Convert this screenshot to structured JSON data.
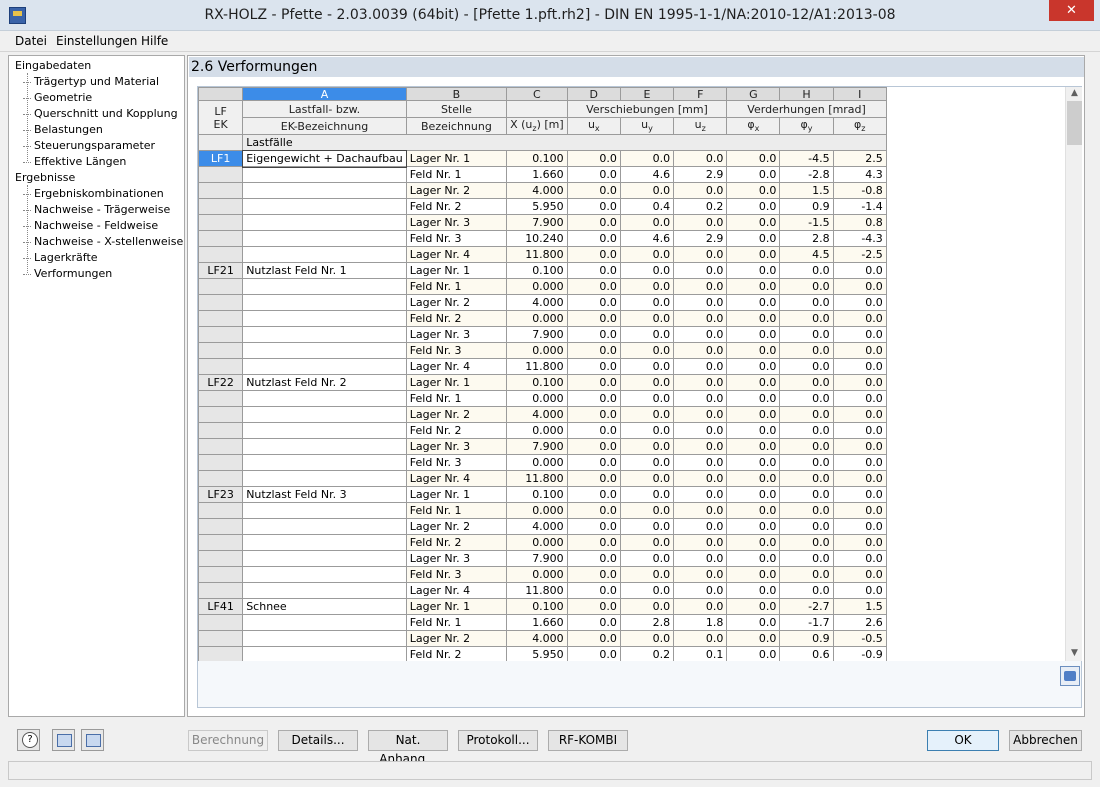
{
  "window": {
    "title": "RX-HOLZ - Pfette - 2.03.0039 (64bit) - [Pfette 1.pft.rh2] - DIN EN 1995-1-1/NA:2010-12/A1:2013-08",
    "close_glyph": "✕"
  },
  "menu": [
    "Datei",
    "Einstellungen",
    "Hilfe"
  ],
  "nav": {
    "groups": [
      {
        "label": "Eingabedaten",
        "items": [
          "Trägertyp und Material",
          "Geometrie",
          "Querschnitt und Kopplung",
          "Belastungen",
          "Steuerungsparameter",
          "Effektive Längen"
        ]
      },
      {
        "label": "Ergebnisse",
        "items": [
          "Ergebniskombinationen",
          "Nachweise - Trägerweise",
          "Nachweise - Feldweise",
          "Nachweise - X-stellenweise",
          "Lagerkräfte",
          "Verformungen"
        ]
      }
    ]
  },
  "panel": {
    "title": "2.6 Verformungen"
  },
  "table": {
    "col_letters": [
      "A",
      "B",
      "C",
      "D",
      "E",
      "F",
      "G",
      "H",
      "I"
    ],
    "header": {
      "lf_ek_1": "LF",
      "lf_ek_2": "EK",
      "a1": "Lastfall- bzw.",
      "a2": "EK-Bezeichnung",
      "b1": "Stelle",
      "b2": "Bezeichnung",
      "c2": "X (u",
      "c2_sub": "z",
      "c2_end": ") [m]",
      "def_group": "Verschiebungen [mm]",
      "rot_group": "Verderhungen [mrad]",
      "ux": "u",
      "ux_sub": "x",
      "uy": "u",
      "uy_sub": "y",
      "uz": "u",
      "uz_sub": "z",
      "px": "φ",
      "px_sub": "x",
      "py": "φ",
      "py_sub": "y",
      "pz": "φ",
      "pz_sub": "z"
    },
    "section_label": "Lastfälle",
    "groups": [
      {
        "lf": "LF1",
        "name": "Eigengewicht + Dachaufbau",
        "rows": [
          [
            "Lager Nr. 1",
            "0.100",
            "0.0",
            "0.0",
            "0.0",
            "0.0",
            "-4.5",
            "2.5"
          ],
          [
            "Feld Nr. 1",
            "1.660",
            "0.0",
            "4.6",
            "2.9",
            "0.0",
            "-2.8",
            "4.3"
          ],
          [
            "Lager Nr. 2",
            "4.000",
            "0.0",
            "0.0",
            "0.0",
            "0.0",
            "1.5",
            "-0.8"
          ],
          [
            "Feld Nr. 2",
            "5.950",
            "0.0",
            "0.4",
            "0.2",
            "0.0",
            "0.9",
            "-1.4"
          ],
          [
            "Lager Nr. 3",
            "7.900",
            "0.0",
            "0.0",
            "0.0",
            "0.0",
            "-1.5",
            "0.8"
          ],
          [
            "Feld Nr. 3",
            "10.240",
            "0.0",
            "4.6",
            "2.9",
            "0.0",
            "2.8",
            "-4.3"
          ],
          [
            "Lager Nr. 4",
            "11.800",
            "0.0",
            "0.0",
            "0.0",
            "0.0",
            "4.5",
            "-2.5"
          ]
        ]
      },
      {
        "lf": "LF21",
        "name": "Nutzlast Feld Nr. 1",
        "rows": [
          [
            "Lager Nr. 1",
            "0.100",
            "0.0",
            "0.0",
            "0.0",
            "0.0",
            "0.0",
            "0.0"
          ],
          [
            "Feld Nr. 1",
            "0.000",
            "0.0",
            "0.0",
            "0.0",
            "0.0",
            "0.0",
            "0.0"
          ],
          [
            "Lager Nr. 2",
            "4.000",
            "0.0",
            "0.0",
            "0.0",
            "0.0",
            "0.0",
            "0.0"
          ],
          [
            "Feld Nr. 2",
            "0.000",
            "0.0",
            "0.0",
            "0.0",
            "0.0",
            "0.0",
            "0.0"
          ],
          [
            "Lager Nr. 3",
            "7.900",
            "0.0",
            "0.0",
            "0.0",
            "0.0",
            "0.0",
            "0.0"
          ],
          [
            "Feld Nr. 3",
            "0.000",
            "0.0",
            "0.0",
            "0.0",
            "0.0",
            "0.0",
            "0.0"
          ],
          [
            "Lager Nr. 4",
            "11.800",
            "0.0",
            "0.0",
            "0.0",
            "0.0",
            "0.0",
            "0.0"
          ]
        ]
      },
      {
        "lf": "LF22",
        "name": "Nutzlast Feld Nr. 2",
        "rows": [
          [
            "Lager Nr. 1",
            "0.100",
            "0.0",
            "0.0",
            "0.0",
            "0.0",
            "0.0",
            "0.0"
          ],
          [
            "Feld Nr. 1",
            "0.000",
            "0.0",
            "0.0",
            "0.0",
            "0.0",
            "0.0",
            "0.0"
          ],
          [
            "Lager Nr. 2",
            "4.000",
            "0.0",
            "0.0",
            "0.0",
            "0.0",
            "0.0",
            "0.0"
          ],
          [
            "Feld Nr. 2",
            "0.000",
            "0.0",
            "0.0",
            "0.0",
            "0.0",
            "0.0",
            "0.0"
          ],
          [
            "Lager Nr. 3",
            "7.900",
            "0.0",
            "0.0",
            "0.0",
            "0.0",
            "0.0",
            "0.0"
          ],
          [
            "Feld Nr. 3",
            "0.000",
            "0.0",
            "0.0",
            "0.0",
            "0.0",
            "0.0",
            "0.0"
          ],
          [
            "Lager Nr. 4",
            "11.800",
            "0.0",
            "0.0",
            "0.0",
            "0.0",
            "0.0",
            "0.0"
          ]
        ]
      },
      {
        "lf": "LF23",
        "name": "Nutzlast Feld Nr. 3",
        "rows": [
          [
            "Lager Nr. 1",
            "0.100",
            "0.0",
            "0.0",
            "0.0",
            "0.0",
            "0.0",
            "0.0"
          ],
          [
            "Feld Nr. 1",
            "0.000",
            "0.0",
            "0.0",
            "0.0",
            "0.0",
            "0.0",
            "0.0"
          ],
          [
            "Lager Nr. 2",
            "4.000",
            "0.0",
            "0.0",
            "0.0",
            "0.0",
            "0.0",
            "0.0"
          ],
          [
            "Feld Nr. 2",
            "0.000",
            "0.0",
            "0.0",
            "0.0",
            "0.0",
            "0.0",
            "0.0"
          ],
          [
            "Lager Nr. 3",
            "7.900",
            "0.0",
            "0.0",
            "0.0",
            "0.0",
            "0.0",
            "0.0"
          ],
          [
            "Feld Nr. 3",
            "0.000",
            "0.0",
            "0.0",
            "0.0",
            "0.0",
            "0.0",
            "0.0"
          ],
          [
            "Lager Nr. 4",
            "11.800",
            "0.0",
            "0.0",
            "0.0",
            "0.0",
            "0.0",
            "0.0"
          ]
        ]
      },
      {
        "lf": "LF41",
        "name": "Schnee",
        "rows": [
          [
            "Lager Nr. 1",
            "0.100",
            "0.0",
            "0.0",
            "0.0",
            "0.0",
            "-2.7",
            "1.5"
          ],
          [
            "Feld Nr. 1",
            "1.660",
            "0.0",
            "2.8",
            "1.8",
            "0.0",
            "-1.7",
            "2.6"
          ],
          [
            "Lager Nr. 2",
            "4.000",
            "0.0",
            "0.0",
            "0.0",
            "0.0",
            "0.9",
            "-0.5"
          ],
          [
            "Feld Nr. 2",
            "5.950",
            "0.0",
            "0.2",
            "0.1",
            "0.0",
            "0.6",
            "-0.9"
          ]
        ]
      }
    ]
  },
  "scroll": {
    "up": "▲",
    "down": "▼"
  },
  "buttons": {
    "berechnung": "Berechnung",
    "details": "Details...",
    "nat_anhang": "Nat. Anhang...",
    "protokoll": "Protokoll...",
    "rf_kombi": "RF-KOMBI",
    "ok": "OK",
    "abbrechen": "Abbrechen"
  }
}
